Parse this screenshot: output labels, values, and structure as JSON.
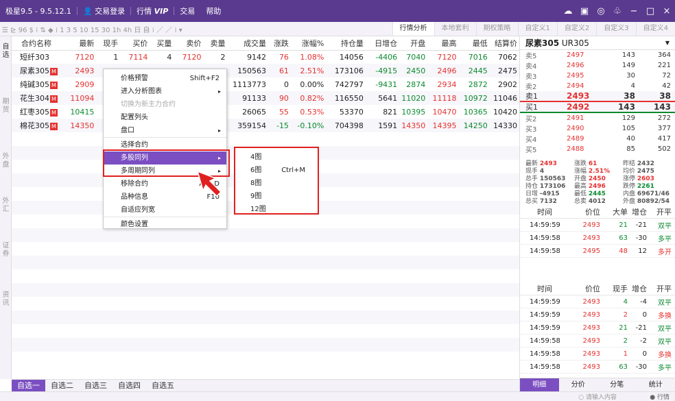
{
  "titlebar": {
    "app": "极星9.5 - 9.5.12.1",
    "login": "交易登录",
    "market": "行情",
    "vip": "VIP",
    "trade": "交易",
    "help": "帮助"
  },
  "toolbar": {
    "tools": "☰ ⊵ 96 $ ⁞ ⇅ ◆ ⁞ 1 3 5 10 15 30 1h 4h 日 自 ⁞ ／ ／ ⁞ ▾",
    "tabs": [
      "行情分析",
      "本地套利",
      "期权策略",
      "自定义1",
      "自定义2",
      "自定义3",
      "自定义4"
    ]
  },
  "sidenav": [
    "自选",
    "期货",
    "外盘",
    "外汇",
    "证券",
    "资讯"
  ],
  "columns": [
    "合约名称",
    "最新",
    "现手",
    "买价",
    "买量",
    "卖价",
    "卖量",
    "成交量",
    "涨跌",
    "涨幅%",
    "持仓量",
    "日增仓",
    "开盘",
    "最高",
    "最低",
    "结算价"
  ],
  "rows": [
    {
      "name": "短纤303",
      "m": "",
      "cells": [
        "7120",
        "1",
        "7114",
        "4",
        "7120",
        "2",
        "9142",
        "76",
        "1.08%",
        "14056",
        "-4406",
        "7040",
        "7120",
        "7016",
        "7062"
      ]
    },
    {
      "name": "尿素305",
      "m": "M",
      "cells": [
        "2493",
        "",
        "",
        "",
        "",
        "",
        "150563",
        "61",
        "2.51%",
        "173106",
        "-4915",
        "2450",
        "2496",
        "2445",
        "2475"
      ]
    },
    {
      "name": "纯碱305",
      "m": "M",
      "cells": [
        "2909",
        "",
        "",
        "",
        "",
        "",
        "1113773",
        "0",
        "0.00%",
        "742797",
        "-9431",
        "2874",
        "2934",
        "2872",
        "2902"
      ]
    },
    {
      "name": "花生304",
      "m": "M",
      "cells": [
        "11094",
        "",
        "",
        "",
        "",
        "",
        "91133",
        "90",
        "0.82%",
        "116550",
        "5641",
        "11020",
        "11118",
        "10972",
        "11046"
      ]
    },
    {
      "name": "红枣305",
      "m": "M",
      "cells": [
        "10415",
        "",
        "",
        "",
        "",
        "",
        "26065",
        "55",
        "0.53%",
        "53370",
        "821",
        "10395",
        "10470",
        "10365",
        "10420"
      ]
    },
    {
      "name": "棉花305",
      "m": "M",
      "cells": [
        "14350",
        "",
        "",
        "",
        "",
        "",
        "359154",
        "-15",
        "-0.10%",
        "704398",
        "1591",
        "14350",
        "14395",
        "14250",
        "14330"
      ]
    }
  ],
  "menu": {
    "items": [
      {
        "label": "价格预警",
        "shortcut": "Shift+F2"
      },
      {
        "label": "进入分析图表",
        "arrow": "▸"
      },
      {
        "label": "切换为新主力合约",
        "disabled": true
      },
      {
        "label": "配置列头"
      },
      {
        "label": "盘口",
        "arrow": "▸"
      },
      {
        "label": "选择合约"
      },
      {
        "label": "多股同列",
        "arrow": "▸",
        "hover": true
      },
      {
        "label": "多周期同列",
        "arrow": "▸"
      },
      {
        "label": "移除合约",
        "shortcut": "Alt+D"
      },
      {
        "label": "品种信息",
        "shortcut": "F10"
      },
      {
        "label": "自适应列宽"
      },
      {
        "label": "颜色设置"
      }
    ],
    "submenu": [
      {
        "label": "4图"
      },
      {
        "label": "6图",
        "shortcut": "Ctrl+M"
      },
      {
        "label": "8图"
      },
      {
        "label": "9图"
      },
      {
        "label": "12图"
      }
    ]
  },
  "bottomtabs": [
    "自选一",
    "自选二",
    "自选三",
    "自选四",
    "自选五"
  ],
  "panel": {
    "name": "尿素305",
    "code": "UR305",
    "asks": [
      [
        "卖5",
        "2497",
        "143",
        "364"
      ],
      [
        "卖4",
        "2496",
        "149",
        "221"
      ],
      [
        "卖3",
        "2495",
        "30",
        "72"
      ],
      [
        "卖2",
        "2494",
        "4",
        "42"
      ],
      [
        "卖1",
        "2493",
        "38",
        "38"
      ]
    ],
    "bids": [
      [
        "买1",
        "2492",
        "143",
        "143"
      ],
      [
        "买2",
        "2491",
        "129",
        "272"
      ],
      [
        "买3",
        "2490",
        "105",
        "377"
      ],
      [
        "买4",
        "2489",
        "40",
        "417"
      ],
      [
        "买5",
        "2488",
        "85",
        "502"
      ]
    ],
    "stats": [
      [
        "最新",
        "2493",
        "涨跌",
        "61",
        "昨结",
        "2432"
      ],
      [
        "现手",
        "4",
        "涨幅",
        "2.51%",
        "均价",
        "2475"
      ],
      [
        "总手",
        "150563",
        "开盘",
        "2450",
        "涨停",
        "2603"
      ],
      [
        "持仓",
        "173106",
        "最高",
        "2496",
        "跌停",
        "2261"
      ],
      [
        "日增",
        "-4915",
        "最低",
        "2445",
        "内盘",
        "69671/46"
      ],
      [
        "总买",
        "7132",
        "总卖",
        "4012",
        "外盘",
        "80892/54"
      ]
    ],
    "tick1_head": [
      "时间",
      "价位",
      "大单",
      "增仓",
      "开平"
    ],
    "tick1": [
      [
        "14:59:59",
        "2493",
        "21",
        "-21",
        "双平"
      ],
      [
        "14:59:58",
        "2493",
        "63",
        "-30",
        "多平"
      ],
      [
        "14:59:58",
        "2495",
        "48",
        "12",
        "多开"
      ]
    ],
    "tick2_head": [
      "时间",
      "价位",
      "现手",
      "增仓",
      "开平"
    ],
    "tick2": [
      [
        "14:59:59",
        "2493",
        "4",
        "-4",
        "双平"
      ],
      [
        "14:59:59",
        "2493",
        "2",
        "0",
        "多换"
      ],
      [
        "14:59:59",
        "2493",
        "21",
        "-21",
        "双平"
      ],
      [
        "14:59:58",
        "2493",
        "2",
        "-2",
        "双平"
      ],
      [
        "14:59:58",
        "2493",
        "1",
        "0",
        "多换"
      ],
      [
        "14:59:58",
        "2493",
        "63",
        "-30",
        "多平"
      ]
    ],
    "tabs": [
      "明细",
      "分价",
      "分笔",
      "统计"
    ]
  },
  "status": {
    "search_placeholder": "请输入内容",
    "market": "行情"
  },
  "colors": {
    "accent": "#7b4fc1",
    "title": "#5a3a8e",
    "up": "#e5312f",
    "down": "#0a8a2f"
  }
}
